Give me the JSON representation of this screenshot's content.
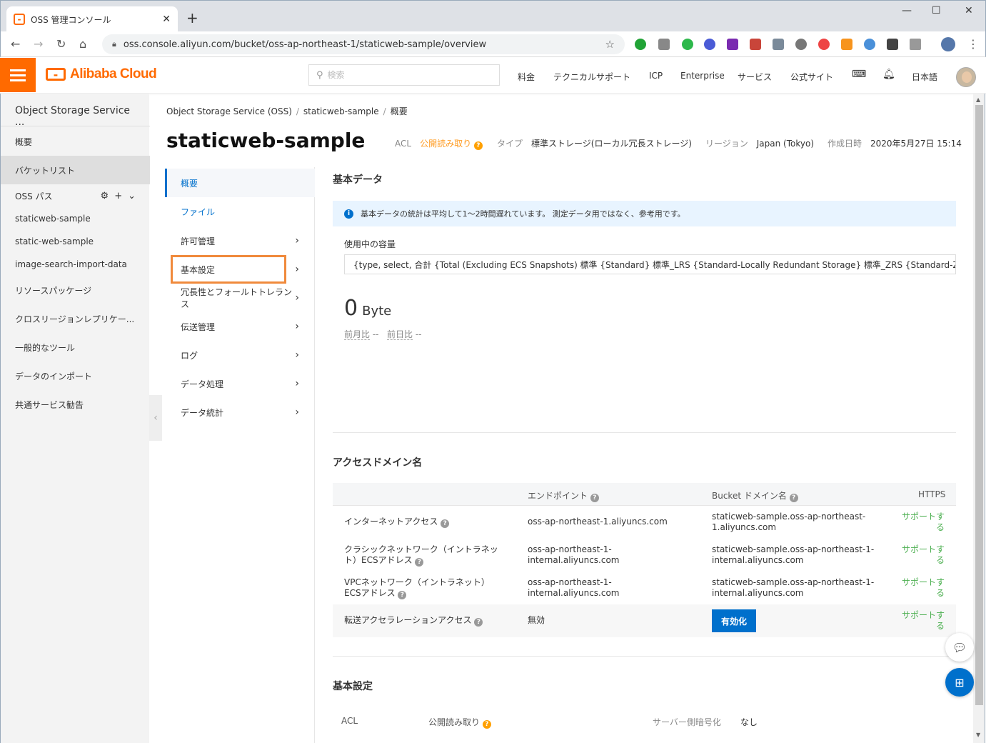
{
  "browser": {
    "tab_title": "OSS 管理コンソール",
    "url": "oss.console.aliyun.com/bucket/oss-ap-northeast-1/staticweb-sample/overview"
  },
  "header": {
    "brand": "Alibaba Cloud",
    "search_placeholder": "検索",
    "nav": [
      "料金",
      "テクニカルサポート",
      "ICP",
      "Enterprise",
      "サービス",
      "公式サイト"
    ],
    "language": "日本語"
  },
  "sidebar": {
    "title": "Object Storage Service ...",
    "items": [
      {
        "label": "概要"
      },
      {
        "label": "バケットリスト"
      },
      {
        "label": "OSS パス"
      },
      {
        "label": "staticweb-sample"
      },
      {
        "label": "static-web-sample"
      },
      {
        "label": "image-search-import-data"
      },
      {
        "label": "リソースパッケージ"
      },
      {
        "label": "クロスリージョンレプリケー..."
      },
      {
        "label": "一般的なツール"
      },
      {
        "label": "データのインポート"
      },
      {
        "label": "共通サービス勧告"
      }
    ]
  },
  "breadcrumb": [
    "Object Storage Service (OSS)",
    "staticweb-sample",
    "概要"
  ],
  "bucket": {
    "name": "staticweb-sample",
    "acl_label": "ACL",
    "acl_value": "公開読み取り",
    "type_label": "タイプ",
    "type_value": "標準ストレージ(ローカル冗長ストレージ)",
    "region_label": "リージョン",
    "region_value": "Japan (Tokyo)",
    "created_label": "作成日時",
    "created_value": "2020年5月27日 15:14"
  },
  "submenu": [
    {
      "label": "概要"
    },
    {
      "label": "ファイル"
    },
    {
      "label": "許可管理"
    },
    {
      "label": "基本設定"
    },
    {
      "label": "冗長性とフォールトトレランス"
    },
    {
      "label": "伝送管理"
    },
    {
      "label": "ログ"
    },
    {
      "label": "データ処理"
    },
    {
      "label": "データ統計"
    }
  ],
  "basic_data": {
    "title": "基本データ",
    "info": "基本データの統計は平均して1〜2時間遅れています。 測定データ用ではなく、参考用です。",
    "capacity_label": "使用中の容量",
    "select_value": "{type, select, 合計 {Total (Excluding ECS Snapshots) 標準 {Standard} 標準_LRS {Standard-Locally Redundant Storage} 標準_ZRS {Standard-Zone-redun",
    "value": "0",
    "unit": "Byte",
    "mom_label": "前月比",
    "mom_value": "--",
    "dod_label": "前日比",
    "dod_value": "--"
  },
  "access_domain": {
    "title": "アクセスドメイン名",
    "headers": {
      "endpoint": "エンドポイント",
      "bucket_domain": "Bucket ドメイン名",
      "https": "HTTPS"
    },
    "rows": [
      {
        "type": "インターネットアクセス",
        "endpoint": "oss-ap-northeast-1.aliyuncs.com",
        "domain1": "staticweb-sample.oss-ap-northeast-",
        "domain2": "1.aliyuncs.com",
        "https1": "サポートす",
        "https2": "る"
      },
      {
        "type1": "クラシックネットワーク（イントラネッ",
        "type2": "ト）ECSアドレス",
        "endpoint1": "oss-ap-northeast-1-",
        "endpoint2": "internal.aliyuncs.com",
        "domain1": "staticweb-sample.oss-ap-northeast-1-",
        "domain2": "internal.aliyuncs.com",
        "https1": "サポートす",
        "https2": "る"
      },
      {
        "type1": "VPCネットワーク（イントラネット）",
        "type2": "ECSアドレス",
        "endpoint1": "oss-ap-northeast-1-",
        "endpoint2": "internal.aliyuncs.com",
        "domain1": "staticweb-sample.oss-ap-northeast-1-",
        "domain2": "internal.aliyuncs.com",
        "https1": "サポートす",
        "https2": "る"
      },
      {
        "type": "転送アクセラレーションアクセス",
        "endpoint": "無効",
        "button": "有効化",
        "https1": "サポートす",
        "https2": "る"
      }
    ]
  },
  "basic_settings": {
    "title": "基本設定",
    "acl_label": "ACL",
    "acl_value": "公開読み取り",
    "sse_label": "サーバー側暗号化",
    "sse_value": "なし"
  }
}
